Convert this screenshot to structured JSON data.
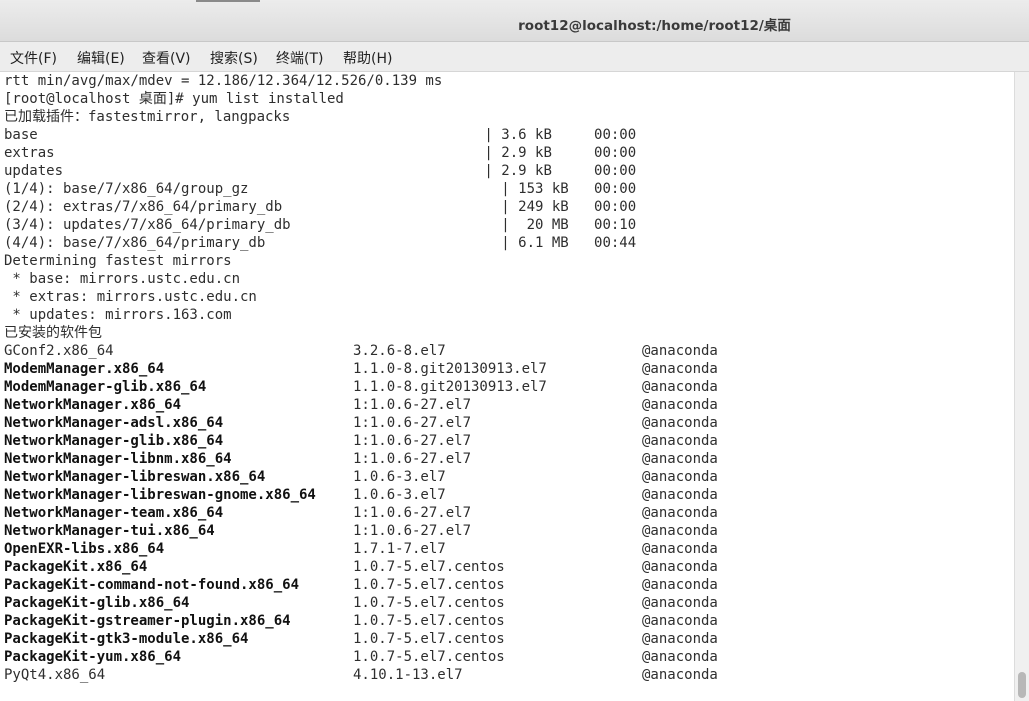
{
  "window": {
    "title": "root12@localhost:/home/root12/桌面"
  },
  "menu": [
    {
      "id": "file",
      "label": "文件(F)"
    },
    {
      "id": "edit",
      "label": "编辑(E)"
    },
    {
      "id": "view",
      "label": "查看(V)"
    },
    {
      "id": "search",
      "label": "搜索(S)"
    },
    {
      "id": "terminal",
      "label": "终端(T)"
    },
    {
      "id": "help",
      "label": "帮助(H)"
    }
  ],
  "terminal": {
    "header_lines": [
      "rtt min/avg/max/mdev = 12.186/12.364/12.526/0.139 ms",
      "[root@localhost 桌面]# yum list installed",
      "已加载插件：fastestmirror, langpacks",
      "base                                                     | 3.6 kB     00:00",
      "extras                                                   | 2.9 kB     00:00",
      "updates                                                  | 2.9 kB     00:00",
      "(1/4): base/7/x86_64/group_gz                              | 153 kB   00:00",
      "(2/4): extras/7/x86_64/primary_db                          | 249 kB   00:00",
      "(3/4): updates/7/x86_64/primary_db                         |  20 MB   00:10",
      "(4/4): base/7/x86_64/primary_db                            | 6.1 MB   00:44",
      "Determining fastest mirrors",
      " * base: mirrors.ustc.edu.cn",
      " * extras: mirrors.ustc.edu.cn",
      " * updates: mirrors.163.com",
      "已安装的软件包"
    ],
    "packages": [
      {
        "name": "GConf2.x86_64",
        "version": "3.2.6-8.el7",
        "repo": "@anaconda",
        "bold": false
      },
      {
        "name": "ModemManager.x86_64",
        "version": "1.1.0-8.git20130913.el7",
        "repo": "@anaconda",
        "bold": true
      },
      {
        "name": "ModemManager-glib.x86_64",
        "version": "1.1.0-8.git20130913.el7",
        "repo": "@anaconda",
        "bold": true
      },
      {
        "name": "NetworkManager.x86_64",
        "version": "1:1.0.6-27.el7",
        "repo": "@anaconda",
        "bold": true
      },
      {
        "name": "NetworkManager-adsl.x86_64",
        "version": "1:1.0.6-27.el7",
        "repo": "@anaconda",
        "bold": true
      },
      {
        "name": "NetworkManager-glib.x86_64",
        "version": "1:1.0.6-27.el7",
        "repo": "@anaconda",
        "bold": true
      },
      {
        "name": "NetworkManager-libnm.x86_64",
        "version": "1:1.0.6-27.el7",
        "repo": "@anaconda",
        "bold": true
      },
      {
        "name": "NetworkManager-libreswan.x86_64",
        "version": "1.0.6-3.el7",
        "repo": "@anaconda",
        "bold": true
      },
      {
        "name": "NetworkManager-libreswan-gnome.x86_64",
        "version": "1.0.6-3.el7",
        "repo": "@anaconda",
        "bold": true
      },
      {
        "name": "NetworkManager-team.x86_64",
        "version": "1:1.0.6-27.el7",
        "repo": "@anaconda",
        "bold": true
      },
      {
        "name": "NetworkManager-tui.x86_64",
        "version": "1:1.0.6-27.el7",
        "repo": "@anaconda",
        "bold": true
      },
      {
        "name": "OpenEXR-libs.x86_64",
        "version": "1.7.1-7.el7",
        "repo": "@anaconda",
        "bold": true
      },
      {
        "name": "PackageKit.x86_64",
        "version": "1.0.7-5.el7.centos",
        "repo": "@anaconda",
        "bold": true
      },
      {
        "name": "PackageKit-command-not-found.x86_64",
        "version": "1.0.7-5.el7.centos",
        "repo": "@anaconda",
        "bold": true
      },
      {
        "name": "PackageKit-glib.x86_64",
        "version": "1.0.7-5.el7.centos",
        "repo": "@anaconda",
        "bold": true
      },
      {
        "name": "PackageKit-gstreamer-plugin.x86_64",
        "version": "1.0.7-5.el7.centos",
        "repo": "@anaconda",
        "bold": true
      },
      {
        "name": "PackageKit-gtk3-module.x86_64",
        "version": "1.0.7-5.el7.centos",
        "repo": "@anaconda",
        "bold": true
      },
      {
        "name": "PackageKit-yum.x86_64",
        "version": "1.0.7-5.el7.centos",
        "repo": "@anaconda",
        "bold": true
      },
      {
        "name": "PyQt4.x86_64",
        "version": "4.10.1-13.el7",
        "repo": "@anaconda",
        "bold": false
      }
    ]
  }
}
